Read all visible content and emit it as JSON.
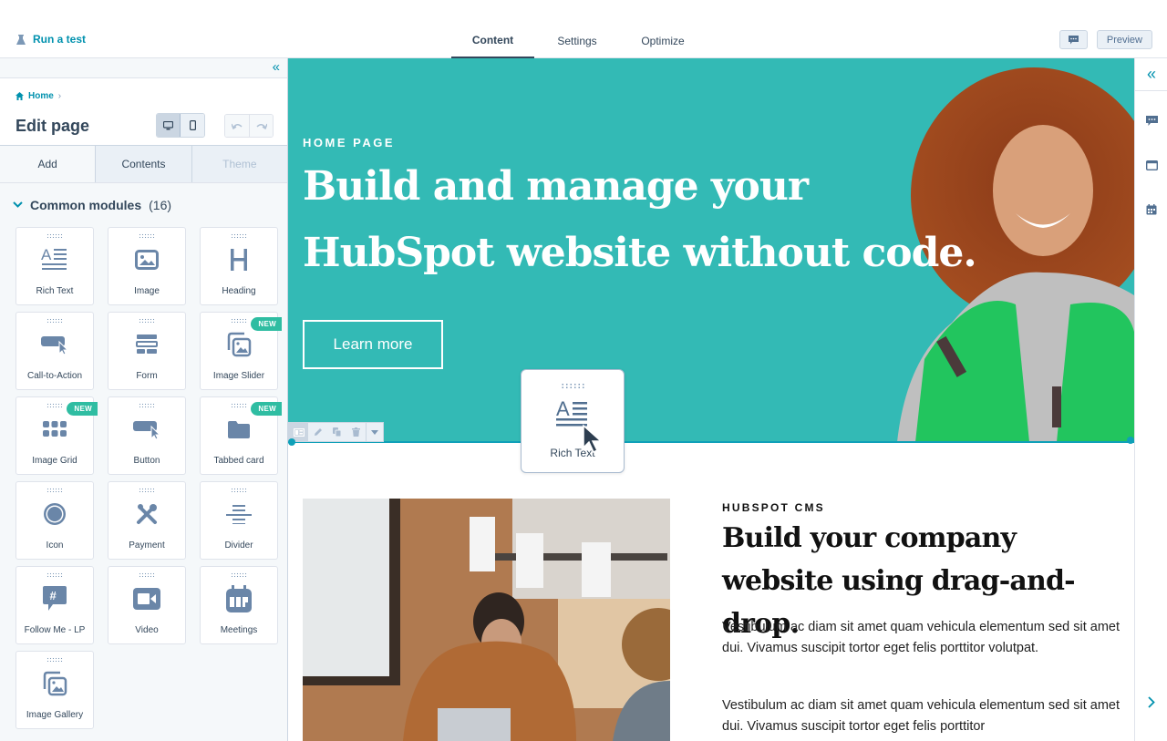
{
  "topbar": {
    "run_test_label": "Run a test",
    "tabs": [
      {
        "label": "Content",
        "active": true
      },
      {
        "label": "Settings",
        "active": false
      },
      {
        "label": "Optimize",
        "active": false
      }
    ],
    "preview_label": "Preview"
  },
  "sidebar": {
    "breadcrumb": {
      "home_label": "Home",
      "separator": "›"
    },
    "title": "Edit page",
    "device_modes": [
      "desktop",
      "mobile"
    ],
    "active_device": "desktop",
    "panel_tabs": [
      {
        "label": "Add",
        "state": "active"
      },
      {
        "label": "Contents",
        "state": "normal"
      },
      {
        "label": "Theme",
        "state": "disabled"
      }
    ],
    "section": {
      "title": "Common modules",
      "count": "(16)"
    },
    "new_badge_label": "NEW",
    "modules": [
      {
        "label": "Rich Text",
        "icon": "rich-text-icon",
        "new": false
      },
      {
        "label": "Image",
        "icon": "image-icon",
        "new": false
      },
      {
        "label": "Heading",
        "icon": "heading-icon",
        "new": false
      },
      {
        "label": "Call-to-Action",
        "icon": "cta-icon",
        "new": false
      },
      {
        "label": "Form",
        "icon": "form-icon",
        "new": false
      },
      {
        "label": "Image Slider",
        "icon": "image-slider-icon",
        "new": true
      },
      {
        "label": "Image Grid",
        "icon": "image-grid-icon",
        "new": true
      },
      {
        "label": "Button",
        "icon": "button-icon",
        "new": false
      },
      {
        "label": "Tabbed card",
        "icon": "folder-icon",
        "new": true
      },
      {
        "label": "Icon",
        "icon": "icon-icon",
        "new": false
      },
      {
        "label": "Payment",
        "icon": "payment-tools-icon",
        "new": false
      },
      {
        "label": "Divider",
        "icon": "divider-icon",
        "new": false
      },
      {
        "label": "Follow Me - LP",
        "icon": "hashtag-chat-icon",
        "new": false
      },
      {
        "label": "Video",
        "icon": "video-camera-icon",
        "new": false
      },
      {
        "label": "Meetings",
        "icon": "meetings-calendar-icon",
        "new": false
      },
      {
        "label": "Image Gallery",
        "icon": "image-gallery-icon",
        "new": false
      }
    ]
  },
  "canvas": {
    "hero": {
      "eyebrow": "HOME PAGE",
      "title": "Build and manage your HubSpot website without code.",
      "button_label": "Learn more",
      "bg_color": "#33bab5"
    },
    "section": {
      "eyebrow": "HUBSPOT CMS",
      "title": "Build your company website using drag-and-drop.",
      "paragraphs": [
        "Vestibulum ac diam sit amet quam vehicula elementum sed sit amet dui. Vivamus suscipit tortor eget felis porttitor volutpat.",
        "Vestibulum ac diam sit amet quam vehicula elementum sed sit amet dui. Vivamus suscipit tortor eget felis porttitor"
      ]
    },
    "drag_ghost_label": "Rich Text"
  },
  "colors": {
    "accent": "#0091ae",
    "new_badge": "#2fbda2",
    "selection": "#0fa0b8",
    "text": "#33475b"
  }
}
